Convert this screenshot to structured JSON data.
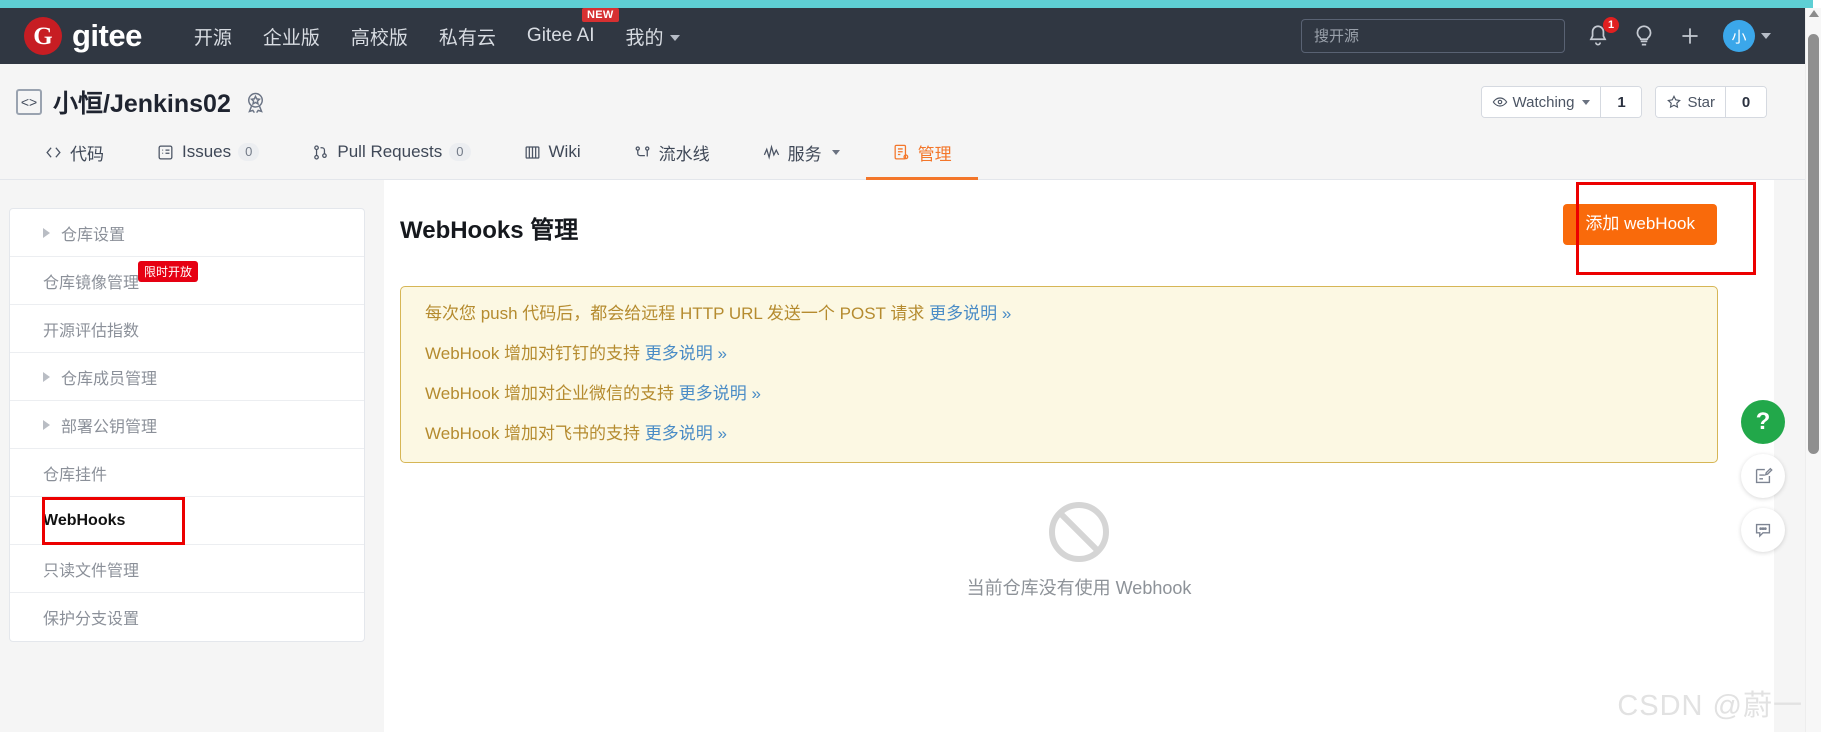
{
  "theme": {
    "accent_orange": "#f3762a",
    "brand_red": "#c71d23",
    "header_bg": "#303742",
    "teal_strip": "#5ecfd4",
    "notice_bg": "#fcf8e3",
    "notice_border": "#d6b656",
    "highlight_red": "#ec0000",
    "link_blue": "#4a8cc6"
  },
  "header": {
    "brand_letter": "G",
    "brand_text": "gitee",
    "nav": [
      {
        "label": "开源",
        "badge": ""
      },
      {
        "label": "企业版",
        "badge": ""
      },
      {
        "label": "高校版",
        "badge": ""
      },
      {
        "label": "私有云",
        "badge": ""
      },
      {
        "label": "Gitee AI",
        "badge": "NEW"
      }
    ],
    "my_menu": "我的",
    "search_placeholder": "搜开源",
    "search_value": "",
    "notification_count": "1",
    "avatar_text": "小"
  },
  "repo": {
    "name": "小恒/Jenkins02",
    "watching_label": "Watching",
    "watching_count": "1",
    "star_label": "Star",
    "star_count": "0",
    "tabs": [
      {
        "label": "代码",
        "count": "",
        "active": false,
        "icon": "code-icon"
      },
      {
        "label": "Issues",
        "count": "0",
        "active": false,
        "icon": "issue-icon"
      },
      {
        "label": "Pull Requests",
        "count": "0",
        "active": false,
        "icon": "pull-request-icon"
      },
      {
        "label": "Wiki",
        "count": "",
        "active": false,
        "icon": "book-icon"
      },
      {
        "label": "流水线",
        "count": "",
        "active": false,
        "icon": "pipeline-icon"
      },
      {
        "label": "服务",
        "count": "",
        "active": false,
        "icon": "service-icon",
        "dropdown": true
      },
      {
        "label": "管理",
        "count": "",
        "active": true,
        "icon": "manage-icon"
      }
    ]
  },
  "sidebar": {
    "items": [
      {
        "label": "仓库设置",
        "expandable": true,
        "selected": false,
        "badge": ""
      },
      {
        "label": "仓库镜像管理",
        "expandable": false,
        "selected": false,
        "badge": "限时开放"
      },
      {
        "label": "开源评估指数",
        "expandable": false,
        "selected": false,
        "badge": ""
      },
      {
        "label": "仓库成员管理",
        "expandable": true,
        "selected": false,
        "badge": ""
      },
      {
        "label": "部署公钥管理",
        "expandable": true,
        "selected": false,
        "badge": ""
      },
      {
        "label": "仓库挂件",
        "expandable": false,
        "selected": false,
        "badge": ""
      },
      {
        "label": "WebHooks",
        "expandable": false,
        "selected": true,
        "badge": ""
      },
      {
        "label": "只读文件管理",
        "expandable": false,
        "selected": false,
        "badge": ""
      },
      {
        "label": "保护分支设置",
        "expandable": false,
        "selected": false,
        "badge": ""
      }
    ]
  },
  "main": {
    "page_title": "WebHooks 管理",
    "add_button": "添加 webHook",
    "notice_lines": [
      {
        "text": "每次您 push 代码后，都会给远程 HTTP URL 发送一个 POST 请求 ",
        "link": "更多说明 »"
      },
      {
        "text": "WebHook 增加对钉钉的支持 ",
        "link": "更多说明 »"
      },
      {
        "text": "WebHook 增加对企业微信的支持 ",
        "link": "更多说明 »"
      },
      {
        "text": "WebHook 增加对飞书的支持 ",
        "link": "更多说明 »"
      }
    ],
    "empty_text": "当前仓库没有使用 Webhook"
  },
  "float_buttons": [
    {
      "name": "help-button",
      "label": "?"
    },
    {
      "name": "feedback-button",
      "label": ""
    },
    {
      "name": "comment-button",
      "label": ""
    }
  ],
  "watermark": "CSDN @蔚一"
}
